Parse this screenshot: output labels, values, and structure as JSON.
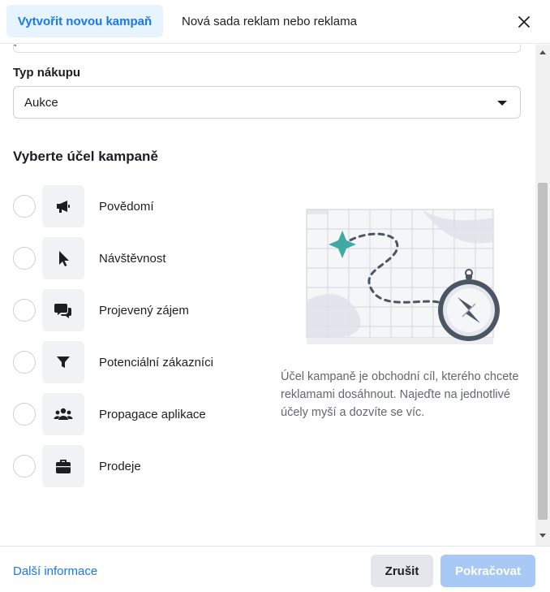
{
  "header": {
    "tabs": [
      {
        "label": "Vytvořit novou kampaň",
        "active": true
      },
      {
        "label": "Nová sada reklam nebo reklama",
        "active": false
      }
    ],
    "close_icon": "close-icon"
  },
  "form": {
    "purchase_type_label": "Typ nákupu",
    "purchase_type_value": "Aukce",
    "objective_title": "Vyberte účel kampaně",
    "objectives": [
      {
        "label": "Povědomí",
        "icon": "megaphone-icon"
      },
      {
        "label": "Návštěvnost",
        "icon": "cursor-icon"
      },
      {
        "label": "Projevený zájem",
        "icon": "chat-bubbles-icon"
      },
      {
        "label": "Potenciální zákazníci",
        "icon": "funnel-icon"
      },
      {
        "label": "Propagace aplikace",
        "icon": "people-icon"
      },
      {
        "label": "Prodeje",
        "icon": "briefcase-icon"
      }
    ],
    "description": "Účel kampaně je obchodní cíl, kterého chcete reklamami dosáhnout. Najeďte na jednotlivé účely myší a dozvíte se víc."
  },
  "footer": {
    "more_info": "Další informace",
    "cancel": "Zrušit",
    "continue": "Pokračovat"
  },
  "colors": {
    "accent": "#1877f2",
    "accent_bg": "#e7f3ff",
    "disabled_button": "#a8c9f5",
    "icon_tile": "#f0f2f5"
  }
}
